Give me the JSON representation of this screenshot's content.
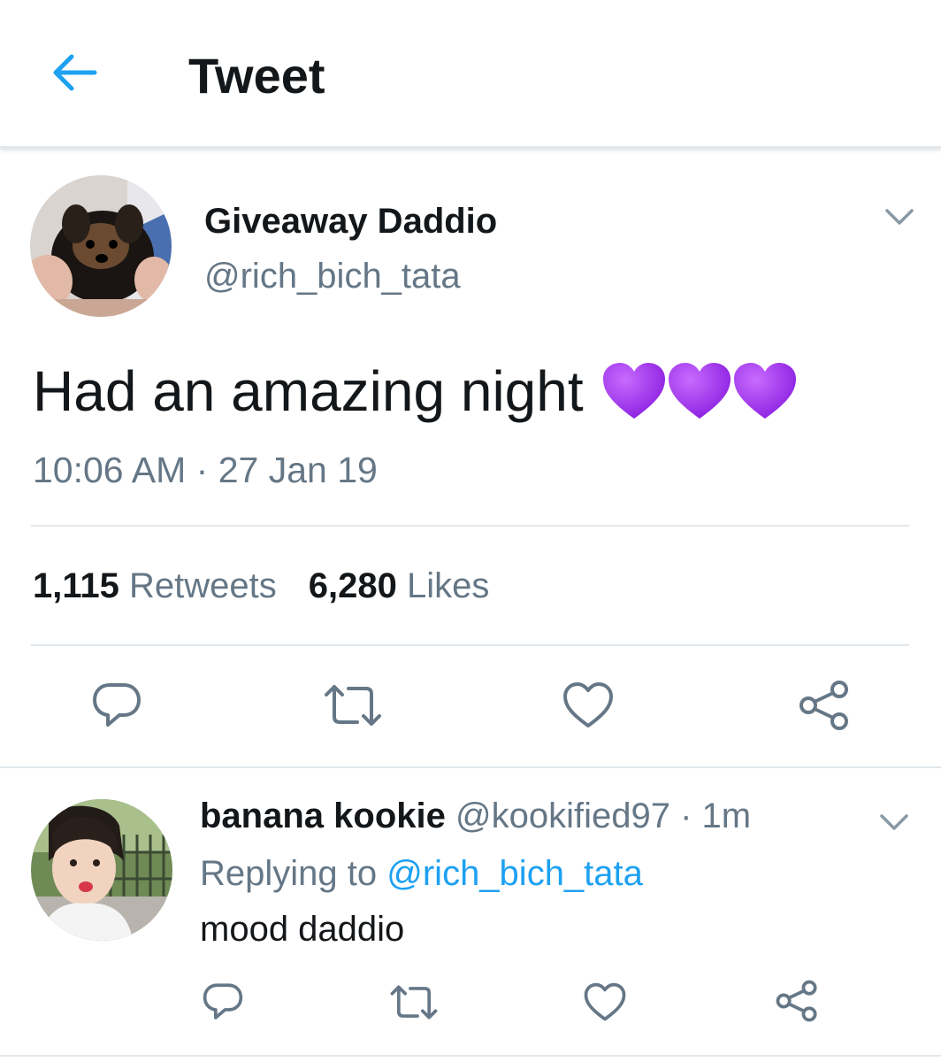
{
  "header": {
    "title": "Tweet",
    "back_icon": "back-arrow-icon",
    "accent": "#1da1f2"
  },
  "tweet": {
    "name": "Giveaway Daddio",
    "handle": "@rich_bich_tata",
    "text": "Had an amazing night",
    "emoji": "purple-heart x3",
    "time": "10:06 AM",
    "separator": "·",
    "date": "27 Jan 19",
    "retweets_count": "1,115",
    "retweets_label": "Retweets",
    "likes_count": "6,280",
    "likes_label": "Likes",
    "actions": [
      "reply-icon",
      "retweet-icon",
      "like-icon",
      "share-icon"
    ]
  },
  "reply": {
    "name": "banana kookie",
    "handle": "@kookified97",
    "separator": "·",
    "age": "1m",
    "replying_prefix": "Replying to",
    "replying_to": "@rich_bich_tata",
    "text": "mood daddio",
    "actions": [
      "reply-icon",
      "retweet-icon",
      "like-icon",
      "share-icon"
    ]
  },
  "colors": {
    "text": "#14171a",
    "secondary": "#657786",
    "link": "#1da1f2",
    "divider": "#e1e8ed",
    "emoji_heart": "#a030e8"
  }
}
